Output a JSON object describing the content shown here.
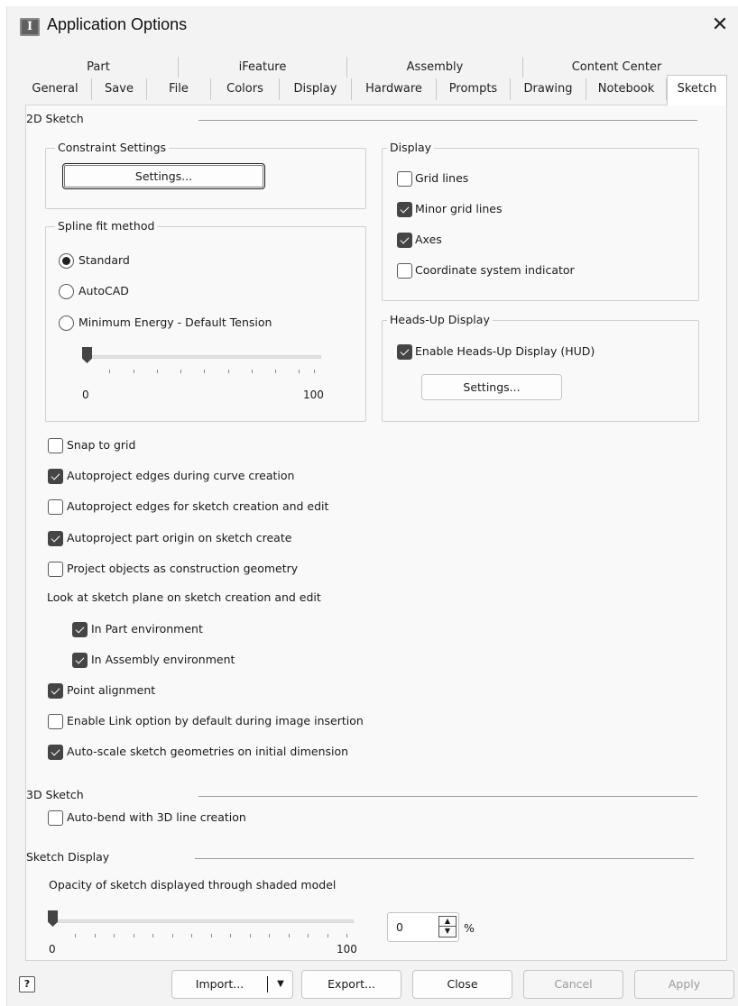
{
  "window": {
    "title": "Application Options",
    "close_glyph": "✕"
  },
  "tabs_row1": [
    "Part",
    "iFeature",
    "Assembly",
    "Content Center"
  ],
  "tabs_row2": [
    "General",
    "Save",
    "File",
    "Colors",
    "Display",
    "Hardware",
    "Prompts",
    "Drawing",
    "Notebook",
    "Sketch"
  ],
  "active_tab": "Sketch",
  "sketch2d": {
    "title": "2D Sketch",
    "constraint": {
      "title": "Constraint Settings",
      "button": "Settings..."
    },
    "spline": {
      "title": "Spline fit method",
      "options": [
        "Standard",
        "AutoCAD",
        "Minimum Energy - Default Tension"
      ],
      "selected": "Standard",
      "slider_min": "0",
      "slider_max": "100",
      "slider_value": 0
    },
    "display": {
      "title": "Display",
      "grid_lines": {
        "label": "Grid lines",
        "checked": false
      },
      "minor_grid_lines": {
        "label": "Minor grid lines",
        "checked": true
      },
      "axes": {
        "label": "Axes",
        "checked": true
      },
      "coord_indicator": {
        "label": "Coordinate system indicator",
        "checked": false
      }
    },
    "hud": {
      "title": "Heads-Up Display",
      "enable": {
        "label": "Enable Heads-Up Display (HUD)",
        "checked": true
      },
      "button": "Settings..."
    },
    "options": {
      "snap": {
        "label": "Snap to grid",
        "checked": false
      },
      "autoproject_curve": {
        "label": "Autoproject edges during curve creation",
        "checked": true
      },
      "autoproject_sketch": {
        "label": "Autoproject edges for sketch creation and edit",
        "checked": false
      },
      "autoproject_origin": {
        "label": "Autoproject part origin on sketch create",
        "checked": true
      },
      "project_construction": {
        "label": "Project objects as construction geometry",
        "checked": false
      },
      "look_at": "Look at sketch plane on sketch creation and edit",
      "in_part": {
        "label": "In Part environment",
        "checked": true
      },
      "in_assembly": {
        "label": "In Assembly environment",
        "checked": true
      },
      "point_alignment": {
        "label": "Point alignment",
        "checked": true
      },
      "enable_link": {
        "label": "Enable Link option by default during image insertion",
        "checked": false
      },
      "auto_scale": {
        "label": "Auto-scale sketch geometries on initial dimension",
        "checked": true
      }
    }
  },
  "sketch3d": {
    "title": "3D Sketch",
    "auto_bend": {
      "label": "Auto-bend with 3D line creation",
      "checked": false
    }
  },
  "sketch_display": {
    "title": "Sketch Display",
    "opacity_label": "Opacity of sketch displayed through shaded model",
    "slider_min": "0",
    "slider_max": "100",
    "opacity_value": "0",
    "unit": "%"
  },
  "footer": {
    "help_icon": "help-icon",
    "import": "Import...",
    "export": "Export...",
    "close": "Close",
    "cancel": "Cancel",
    "apply": "Apply"
  }
}
